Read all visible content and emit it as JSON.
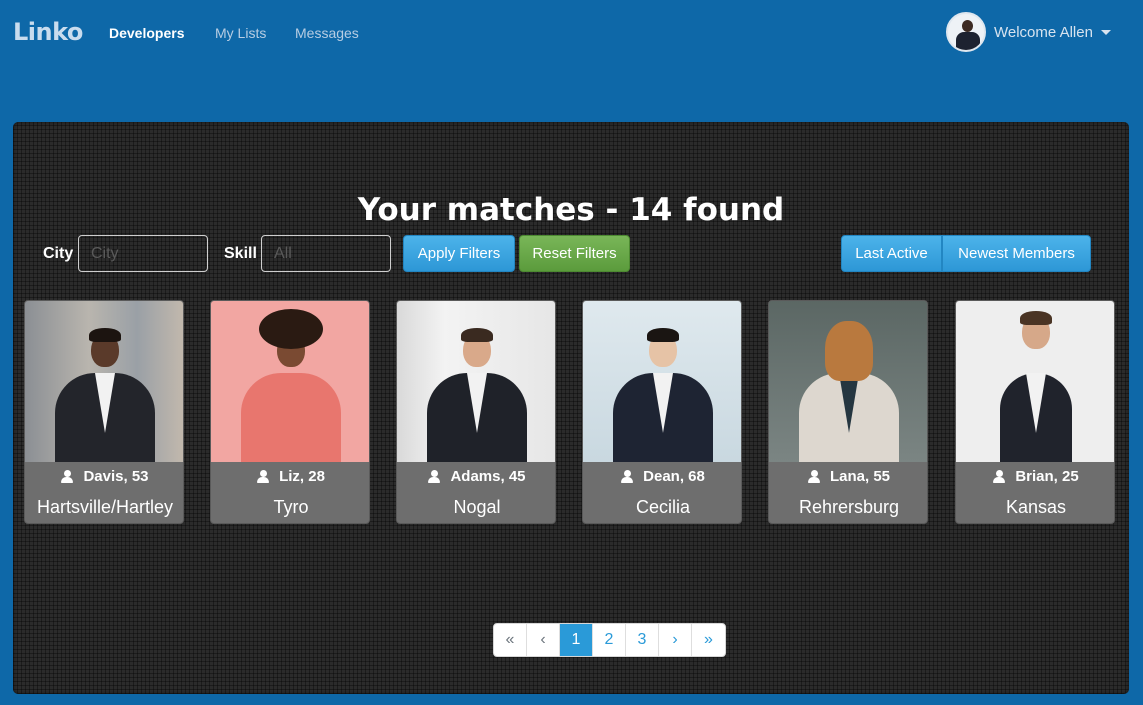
{
  "nav": {
    "brand": "Linko",
    "links": [
      "Developers",
      "My Lists",
      "Messages"
    ],
    "welcome": "Welcome Allen"
  },
  "main": {
    "title": "Your matches - 14 found",
    "filters": {
      "city_label": "City",
      "city_placeholder": "City",
      "skill_label": "Skill",
      "skill_placeholder": "All",
      "apply": "Apply Filters",
      "reset": "Reset Filters"
    },
    "sort": {
      "last_active": "Last Active",
      "newest": "Newest Members"
    },
    "members": [
      {
        "name_age": "Davis, 53",
        "city": "Hartsville/Hartley"
      },
      {
        "name_age": "Liz, 28",
        "city": "Tyro"
      },
      {
        "name_age": "Adams, 45",
        "city": "Nogal"
      },
      {
        "name_age": "Dean, 68",
        "city": "Cecilia"
      },
      {
        "name_age": "Lana, 55",
        "city": "Rehrersburg"
      },
      {
        "name_age": "Brian, 25",
        "city": "Kansas"
      }
    ],
    "pagination": [
      "«",
      "‹",
      "1",
      "2",
      "3",
      "›",
      "»"
    ],
    "current_page": "1"
  },
  "colors": {
    "header_bg": "#0e68a8",
    "accent": "#2a9ad8",
    "reset_green": "#5b9b3c"
  }
}
